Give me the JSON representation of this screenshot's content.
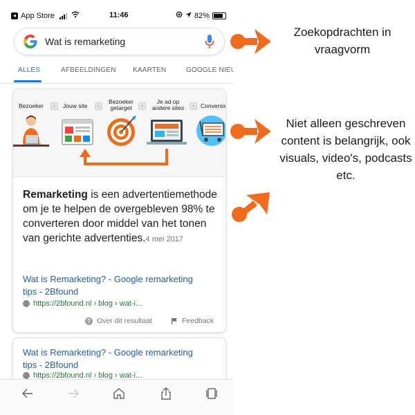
{
  "status_bar": {
    "carrier": "App Store",
    "time": "11:46",
    "battery": "82%",
    "battery_level": 0.82
  },
  "search": {
    "query": "Wat is remarketing",
    "logo_icon": "google-g-logo",
    "voice_icon": "microphone-icon"
  },
  "tabs": [
    {
      "label": "ALLES",
      "active": true
    },
    {
      "label": "AFBEELDINGEN",
      "active": false
    },
    {
      "label": "KAARTEN",
      "active": false
    },
    {
      "label": "GOOGLE NIEU",
      "active": false
    }
  ],
  "illustration": {
    "steps": [
      "Bezoeker",
      "Jouw site",
      "Bezoeker getarget",
      "Je ad op andere sites",
      "Conversie"
    ],
    "icons": [
      "person-at-laptop-icon",
      "website-icon",
      "target-icon",
      "ad-on-laptop-icon",
      "shopping-cart-icon"
    ]
  },
  "result1": {
    "snippet_bold": "Remarketing",
    "snippet_rest": " is een advertentiemethode om je te helpen de overgebleven 98% te converteren door middel van het tonen van gerichte advertenties.",
    "date": "4 mei 2017",
    "title_line1": "Wat is Remarketing? - Google remarketing",
    "title_line2": "tips - 2Bfound",
    "url": "https://2bfound.nl › blog › wat-i...",
    "about": "Over dit resultaat",
    "feedback": "Feedback"
  },
  "result2": {
    "title_line1": "Wat is Remarketing? - Google remarketing",
    "title_line2": "tips - 2Bfound",
    "url": "https://2bfound.nl › blog › wat-i..."
  },
  "toolbar": {
    "icons": [
      "back-arrow-icon",
      "forward-arrow-icon",
      "home-icon",
      "share-icon",
      "tabs-icon"
    ]
  },
  "annotations": {
    "note1": "Zoekopdrachten in vraagvorm",
    "note2": "Niet alleen geschreven content is belangrijk, ook visuals, video's, podcasts etc.",
    "accent_color": "#f26b1d"
  }
}
